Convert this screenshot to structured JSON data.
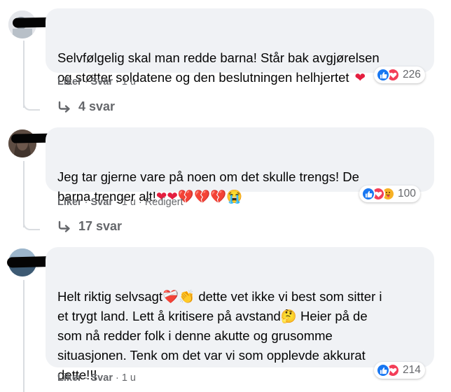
{
  "comments": [
    {
      "text": "Selvfølgelig skal man redde barna! Står bak avgjørelsen\nog støtter soldatene og den beslutningen helhjertet",
      "emoji": "❤",
      "actions": {
        "like": "Liker",
        "reply": "Svar",
        "age": "1 u",
        "edited": ""
      },
      "reactions": [
        "like",
        "love"
      ],
      "reaction_count": "226",
      "replies_label": "4 svar"
    },
    {
      "text": "Jeg tar gjerne vare på noen om det skulle trengs! De\nbarna trenger alt!",
      "emoji": "❤❤💔💔💔😭",
      "actions": {
        "like": "Liker",
        "reply": "Svar",
        "age": "1 u",
        "edited": "Redigert"
      },
      "reactions": [
        "like",
        "love",
        "care"
      ],
      "reaction_count": "100",
      "replies_label": "17 svar"
    },
    {
      "text_parts": [
        "Helt riktig selvsagt",
        "❤‍🩹👏",
        " dette vet ikke vi best som sitter i\net trygt land. Lett å kritisere på avstand",
        "🤔",
        " Heier på de\nsom nå redder folk i denne akutte og grusomme\nsituasjonen. Tenk om det var vi som opplevde akkurat\ndette!!!"
      ],
      "actions": {
        "like": "Liker",
        "reply": "Svar",
        "age": "1 u",
        "edited": ""
      },
      "reactions": [
        "like",
        "love"
      ],
      "reaction_count": "214"
    }
  ],
  "icons": {
    "reply_arrow": "reply-arrow-icon",
    "like": "thumbs-up-icon",
    "love": "heart-icon",
    "care": "care-hug-icon"
  },
  "colors": {
    "like_blue": "#1877f2",
    "love_red": "#f33e58",
    "care_yellow": "#f7b125",
    "bubble_bg": "#f0f2f5",
    "meta_gray": "#65676b"
  }
}
